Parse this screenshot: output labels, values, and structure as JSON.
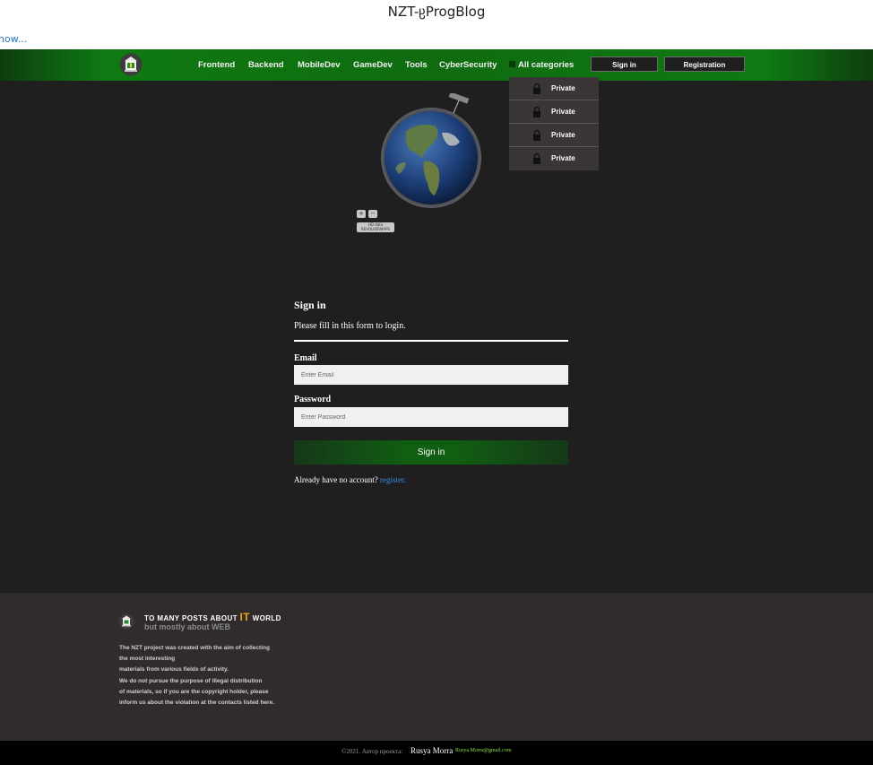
{
  "browser": {
    "title": "NZT-ჸProgBlog",
    "show_link": "now..."
  },
  "nav": {
    "links": [
      "Frontend",
      "Backend",
      "MobileDev",
      "GameDev",
      "Tools",
      "CyberSecurity",
      "All categories"
    ],
    "signin_button": "Sign in",
    "registration_button": "Registration",
    "accent_color": "#0f7a12"
  },
  "dropdown": {
    "items": [
      "Private",
      "Private",
      "Private",
      "Private"
    ]
  },
  "map_widget": {
    "zoom_in": "+",
    "zoom_out": "−",
    "badge_line1": "HD data",
    "badge_line2": "REVOLVERMAPS"
  },
  "form": {
    "title": "Sign in",
    "subtitle": "Please fill in this form to login.",
    "email_label": "Email",
    "email_placeholder": "Enter Email",
    "password_label": "Password",
    "password_placeholder": "Enter Password",
    "submit": "Sign in",
    "register_text": "Already have no account?",
    "register_link": "register."
  },
  "footer": {
    "heading_pre": "TO MANY POSTS ABOUT",
    "heading_it": "IT",
    "heading_post": "WORLD",
    "subheading": "but mostly about WEB",
    "description": [
      "The NZT project was created with the aim of collecting",
      "the most interesting",
      "materials from various fields of activity.",
      "We do not pursue the purpose of illegal distribution",
      "of materials, so if you are the copyright holder, please",
      "inform us about the violation at the contacts listed here."
    ],
    "copyright": "©2021. Автор проекта:",
    "author": "Rusya Morra",
    "email": "Rusya.Morra@gmail.com"
  }
}
